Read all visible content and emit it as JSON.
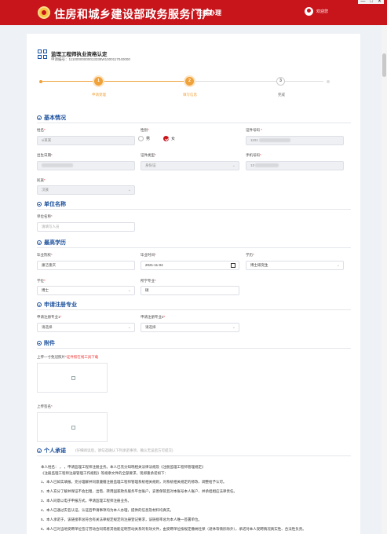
{
  "header": {
    "site_title": "住房和城乡建设部政务服务门户",
    "online_tab": "在线办理",
    "welcome": "欢迎您"
  },
  "page": {
    "title": "监理工程师执业资格认定",
    "apply_no": "申请编号：11100000000013338W1000117040000"
  },
  "steps": [
    {
      "num": "1",
      "label": "申请受理"
    },
    {
      "num": "2",
      "label": "填写信息"
    },
    {
      "num": "3",
      "label": "完成"
    }
  ],
  "basic": {
    "heading": "基本情况",
    "name_label": "姓名",
    "name_value": "xi某某",
    "gender_label": "性别",
    "gender_male": "男",
    "gender_female": "女",
    "id_label": "证件号码",
    "id_value": "1101",
    "birth_label": "出生日期",
    "cert_type_label": "证件类型",
    "cert_type_value": "身份证",
    "phone_label": "手机号码",
    "phone_value": "13",
    "nation_label": "民族",
    "nation_value": "汉族"
  },
  "unit": {
    "heading": "单位名称",
    "label": "单位名称",
    "placeholder": "请填写人员",
    "required": "*"
  },
  "edu": {
    "heading": "最高学历",
    "school_label": "毕业院校",
    "school_value": "廉洁重庆",
    "grad_label": "毕业时间",
    "grad_value": "2021-11-04",
    "degree_label": "学历",
    "degree_value": "博士研究生",
    "xuewei_label": "学位",
    "xuewei_value": "博士",
    "major_label": "所学专业",
    "major_value": "硕"
  },
  "reg": {
    "heading": "申请注册专业",
    "major1_label": "申请注册专业1",
    "major1_value": "请选择",
    "major2_label": "申请注册专业2",
    "major2_value": "请选择"
  },
  "attach": {
    "heading": "附件",
    "upload1_label": "上传一寸免冠照片",
    "upload1_tip": "*证件照在线工具下载",
    "upload2_label": "上传签名"
  },
  "promise": {
    "heading": "个人承诺",
    "sub": "(仔细阅读后，请勾选确认下列承诺事项，确认无误后方可提交)",
    "lines": [
      "本人姓名：                                    ，                                    ，申请监理工程师注册业务。本人已充分知晓相关法律法规及《注册监理工程师管理规定》",
      "《注册监理工程师注册管理工作规程》等规章文件的全部要求，现郑重承诺如下：",
      "1、本人已如实填报，充分理解并同意遵循注册监理工程师管理系统相关规则，对系统相关规定的修改、调整给予认可。",
      "2、本人充分了解并保证不会出租、出借、转用国家政务服务平台账户，妥善保管且对本账号本人账户、并承担相应法律责任。",
      "3、本人同意以电子申报方式，申请监理工程师注册业务。",
      "4、本人已通过实名认证，认证后申请事项均为本人办理，提供的信息及材料均真实。",
      "5、本人承诺于，该链接率总符合有关法律规定规定的注册登记要求，该链接率总为本人唯一签署单位。",
      "6、本人已对当地受聘单位签订劳动合同或者其他能证明劳动关系的有效文件，由受聘单位按规定缴纳社保（退休等情形除外），承诺对本人受聘情况真实性、合法性负责。"
    ]
  }
}
